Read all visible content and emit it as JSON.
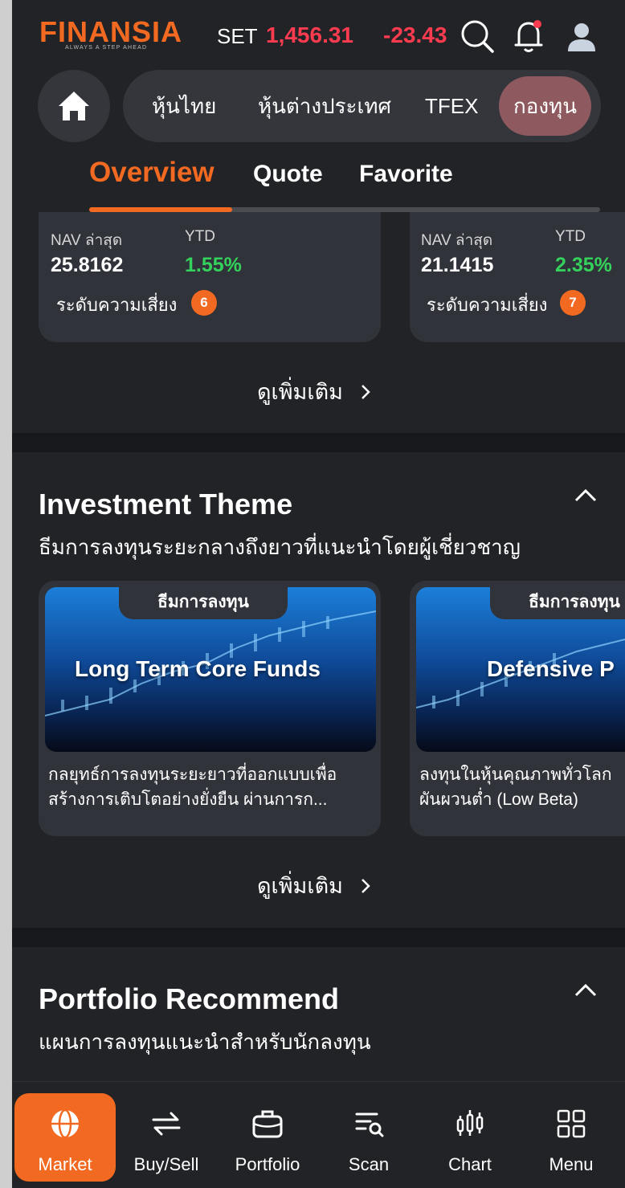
{
  "header": {
    "logo_text": "FINANSIA",
    "logo_tagline": "ALWAYS A STEP AHEAD",
    "index_label": "SET",
    "index_value": "1,456.31",
    "index_change": "-23.43",
    "icons": [
      "search-icon",
      "bell-icon",
      "user-icon"
    ],
    "accent_color": "#f26a21",
    "negative_color": "#ff3b4f"
  },
  "market_tabs": {
    "home_icon": "home-icon",
    "items": [
      {
        "label": "หุ้นไทย"
      },
      {
        "label": "หุ้นต่างประเทศ"
      },
      {
        "label": "TFEX"
      },
      {
        "label": "กองทุน",
        "active": true
      }
    ]
  },
  "sub_tabs": {
    "items": [
      {
        "label": "Overview",
        "active": true
      },
      {
        "label": "Quote"
      },
      {
        "label": "Favorite"
      }
    ]
  },
  "fund_cards": [
    {
      "nav_label": "NAV ล่าสุด",
      "ytd_label": "YTD",
      "nav": "25.8162",
      "ytd": "1.55%",
      "risk_label": "ระดับความเสี่ยง",
      "risk": "6"
    },
    {
      "nav_label": "NAV ล่าสุด",
      "ytd_label": "YTD",
      "nav": "21.1415",
      "ytd": "2.35%",
      "risk_label": "ระดับความเสี่ยง",
      "risk": "7"
    }
  ],
  "more_label": "ดูเพิ่มเติม",
  "investment_theme": {
    "title": "Investment Theme",
    "subtitle": "ธีมการลงทุนระยะกลางถึงยาวที่แนะนำโดยผู้เชี่ยวชาญ",
    "cards": [
      {
        "tag": "ธีมการลงทุน",
        "title": "Long Term Core Funds",
        "desc_line1": "กลยุทธ์การลงทุนระยะยาวที่ออกแบบเพื่อ",
        "desc_line2": "สร้างการเติบโตอย่างยั่งยืน ผ่านการก..."
      },
      {
        "tag": "ธีมการลงทุน",
        "title": "Defensive P",
        "desc_line1": "ลงทุนในหุ้นคุณภาพทั่วโลก",
        "desc_line2": "ผันผวนต่ำ (Low Beta)"
      }
    ]
  },
  "portfolio_recommend": {
    "title": "Portfolio Recommend",
    "subtitle": "แผนการลงทุนแนะนำสำหรับนักลงทุน"
  },
  "bottom_nav": {
    "items": [
      {
        "label": "Market",
        "icon": "globe-icon",
        "active": true
      },
      {
        "label": "Buy/Sell",
        "icon": "swap-icon"
      },
      {
        "label": "Portfolio",
        "icon": "briefcase-icon"
      },
      {
        "label": "Scan",
        "icon": "scan-icon"
      },
      {
        "label": "Chart",
        "icon": "candlestick-icon"
      },
      {
        "label": "Menu",
        "icon": "grid-icon"
      }
    ]
  }
}
